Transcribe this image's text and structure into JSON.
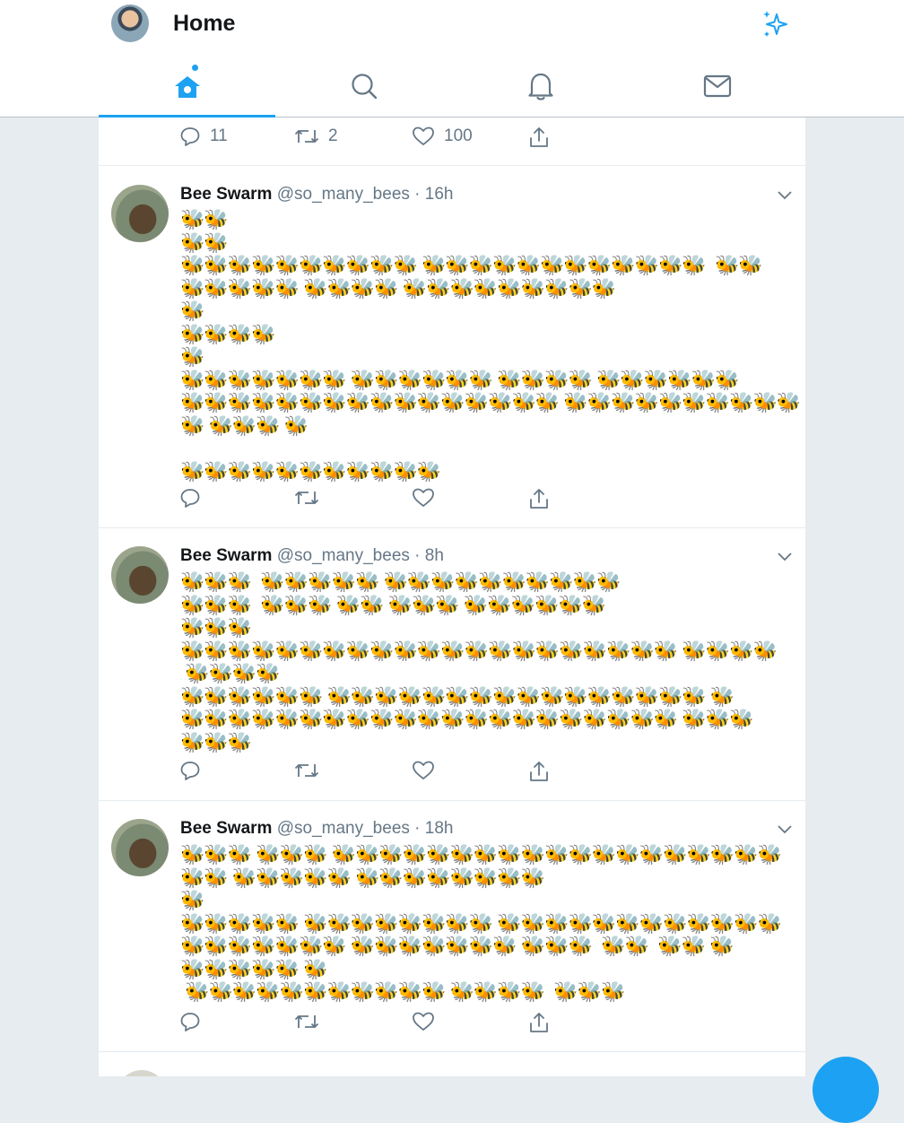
{
  "header": {
    "title": "Home",
    "tabs": [
      {
        "name": "home",
        "icon": "home-icon",
        "active": true
      },
      {
        "name": "search",
        "icon": "search-icon",
        "active": false
      },
      {
        "name": "notifications",
        "icon": "bell-icon",
        "active": false
      },
      {
        "name": "messages",
        "icon": "mail-icon",
        "active": false
      }
    ],
    "accent": "#1da1f2"
  },
  "top_actions": {
    "replies": "11",
    "retweets": "2",
    "likes": "100"
  },
  "tweets": [
    {
      "name": "Bee Swarm",
      "handle": "@so_many_bees",
      "time": "· 16h",
      "bees": "🐝🐝\n🐝🐝\n🐝🐝🐝🐝🐝🐝🐝🐝🐝🐝 🐝🐝🐝🐝🐝🐝🐝🐝🐝🐝🐝🐝  🐝🐝\n🐝🐝🐝🐝🐝 🐝🐝🐝🐝 🐝🐝🐝🐝🐝🐝🐝🐝🐝\n🐝\n🐝🐝🐝🐝\n🐝\n🐝🐝🐝🐝🐝🐝🐝 🐝🐝🐝🐝🐝🐝 🐝🐝🐝🐝 🐝🐝🐝🐝🐝🐝\n🐝🐝🐝🐝🐝🐝🐝🐝🐝🐝🐝🐝🐝🐝🐝🐝 🐝🐝🐝🐝🐝🐝🐝🐝🐝🐝\n🐝 🐝🐝🐝 🐝\n\n🐝🐝🐝🐝🐝🐝🐝🐝🐝🐝🐝"
    },
    {
      "name": "Bee Swarm",
      "handle": "@so_many_bees",
      "time": "· 8h",
      "bees": "🐝🐝🐝  🐝🐝🐝🐝🐝 🐝🐝🐝🐝🐝🐝🐝🐝🐝🐝\n🐝🐝🐝  🐝🐝🐝 🐝🐝 🐝🐝🐝 🐝🐝🐝🐝🐝🐝\n🐝🐝🐝\n🐝🐝🐝🐝🐝🐝🐝🐝🐝🐝🐝🐝🐝🐝🐝🐝🐝🐝🐝🐝🐝 🐝🐝🐝🐝\n 🐝🐝🐝🐝\n🐝🐝🐝🐝🐝🐝 🐝🐝🐝🐝🐝🐝🐝🐝🐝🐝🐝🐝🐝🐝🐝🐝 🐝\n🐝🐝🐝🐝🐝🐝🐝🐝🐝🐝🐝🐝🐝🐝🐝🐝🐝🐝🐝🐝🐝 🐝🐝🐝\n🐝🐝🐝"
    },
    {
      "name": "Bee Swarm",
      "handle": "@so_many_bees",
      "time": "· 18h",
      "bees": "🐝🐝🐝 🐝🐝🐝 🐝🐝🐝🐝🐝🐝🐝🐝🐝🐝🐝🐝🐝🐝🐝🐝🐝🐝🐝\n🐝🐝 🐝🐝🐝🐝🐝 🐝🐝🐝🐝🐝🐝🐝🐝\n🐝\n🐝🐝🐝🐝🐝 🐝🐝🐝🐝🐝🐝🐝🐝 🐝🐝🐝🐝🐝🐝🐝🐝🐝🐝🐝🐝\n🐝🐝🐝🐝🐝🐝🐝 🐝🐝🐝🐝🐝🐝🐝 🐝🐝🐝  🐝🐝  🐝🐝 🐝\n🐝🐝🐝🐝🐝 🐝\n 🐝🐝🐝🐝🐝🐝🐝🐝🐝🐝🐝 🐝🐝🐝🐝  🐝🐝🐝"
    }
  ]
}
